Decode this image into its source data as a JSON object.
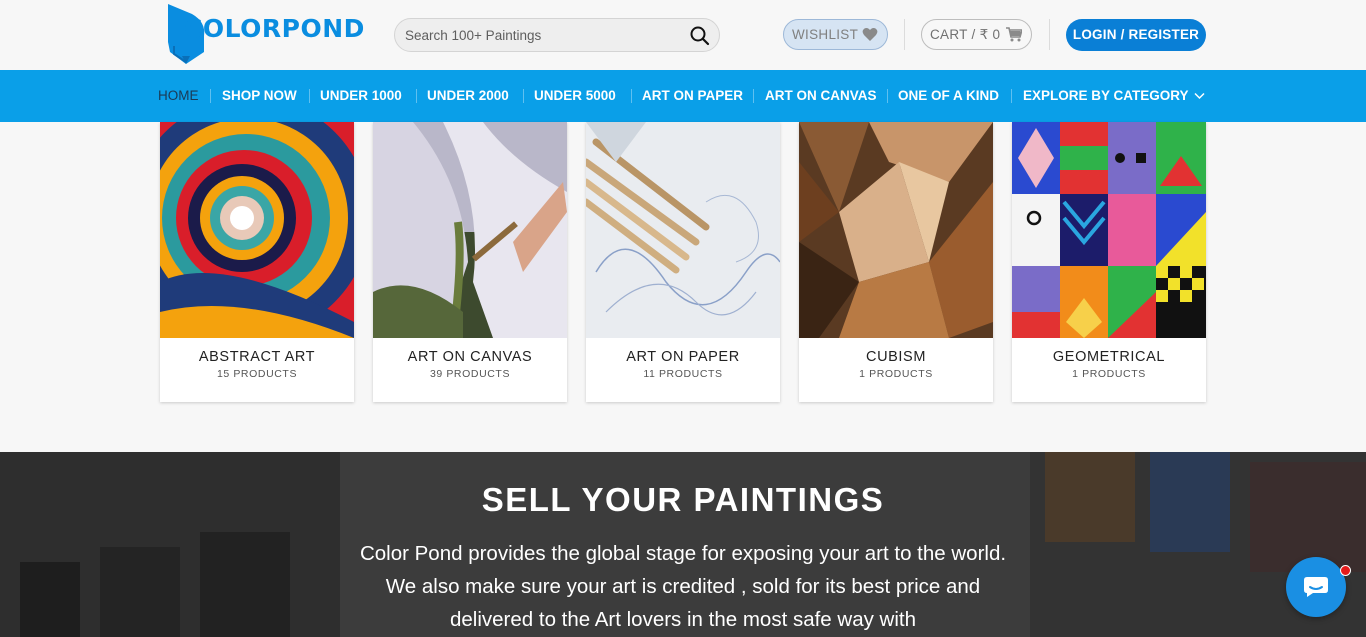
{
  "header": {
    "logo_text": "COLORPOND",
    "search_placeholder": "Search 100+ Paintings",
    "wishlist_label": "WISHLIST",
    "cart_label": "CART / ₹ 0",
    "login_label": "LOGIN / REGISTER"
  },
  "nav": {
    "items": [
      {
        "label": "HOME"
      },
      {
        "label": "SHOP NOW"
      },
      {
        "label": "UNDER 1000"
      },
      {
        "label": "UNDER 2000"
      },
      {
        "label": "UNDER 5000"
      },
      {
        "label": "ART ON PAPER"
      },
      {
        "label": "ART ON CANVAS"
      },
      {
        "label": "ONE OF A KIND"
      },
      {
        "label": "EXPLORE BY CATEGORY"
      }
    ]
  },
  "categories": [
    {
      "title": "ABSTRACT ART",
      "count": "15 PRODUCTS"
    },
    {
      "title": "ART ON CANVAS",
      "count": "39 PRODUCTS"
    },
    {
      "title": "ART ON PAPER",
      "count": "11 PRODUCTS"
    },
    {
      "title": "CUBISM",
      "count": "1 PRODUCTS"
    },
    {
      "title": "GEOMETRICAL",
      "count": "1 PRODUCTS"
    }
  ],
  "sell": {
    "title": "SELL YOUR PAINTINGS",
    "text": "Color Pond provides the global stage for exposing your art to the world. We also make sure your art is credited , sold for its best price and delivered to the Art lovers in the most safe way with"
  },
  "colors": {
    "brand": "#0a8de0",
    "nav_bg": "#0a9fe8",
    "login_bg": "#0a7fd6",
    "chat_bg": "#1a8fe3",
    "chat_badge": "#e51b1b"
  },
  "icons": {
    "search": "search-icon",
    "wishlist": "heart-icon",
    "cart": "cart-icon",
    "dropdown": "chevron-down-icon",
    "chat": "chat-icon"
  }
}
